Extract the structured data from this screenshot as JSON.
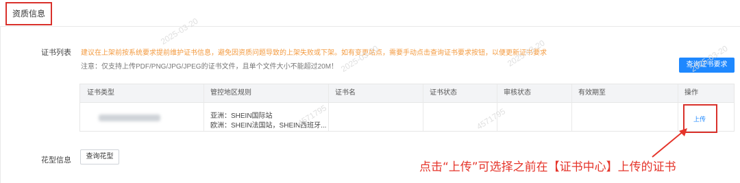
{
  "section_title": "资质信息",
  "certificate": {
    "label": "证书列表",
    "tip": "建议在上架前按系统要求提前维护证书信息，避免因资质问题导致的上架失败或下架。如有变更站点，需要手动点击查询证书要求按钮，以便更新证书要求",
    "note": "注意：仅支持上传PDF/PNG/JPG/JPEG的证书文件，且单个文件大小不能超过20M！",
    "query_button": "查询证书要求"
  },
  "table": {
    "headers": [
      "证书类型",
      "管控地区规则",
      "证书名",
      "证书状态",
      "审核状态",
      "有效期至",
      "操作"
    ],
    "rows": [
      {
        "region_line1": "亚洲：SHEIN国际站",
        "region_line2": "欧洲：SHEIN法国站，SHEIN西班牙...",
        "action": "上传"
      }
    ]
  },
  "pattern": {
    "label": "花型信息",
    "button": "查询花型"
  },
  "annotation": "点击“上传”可选择之前在【证书中心】上传的证书",
  "watermarks": [
    "2025-03-20",
    "4571795",
    "2025-03-20",
    "4571795",
    "2025-03-20",
    "2025-03-20"
  ],
  "colors": {
    "primary": "#1e88ff",
    "highlight": "#d9302a",
    "tip": "#f39a3f"
  }
}
